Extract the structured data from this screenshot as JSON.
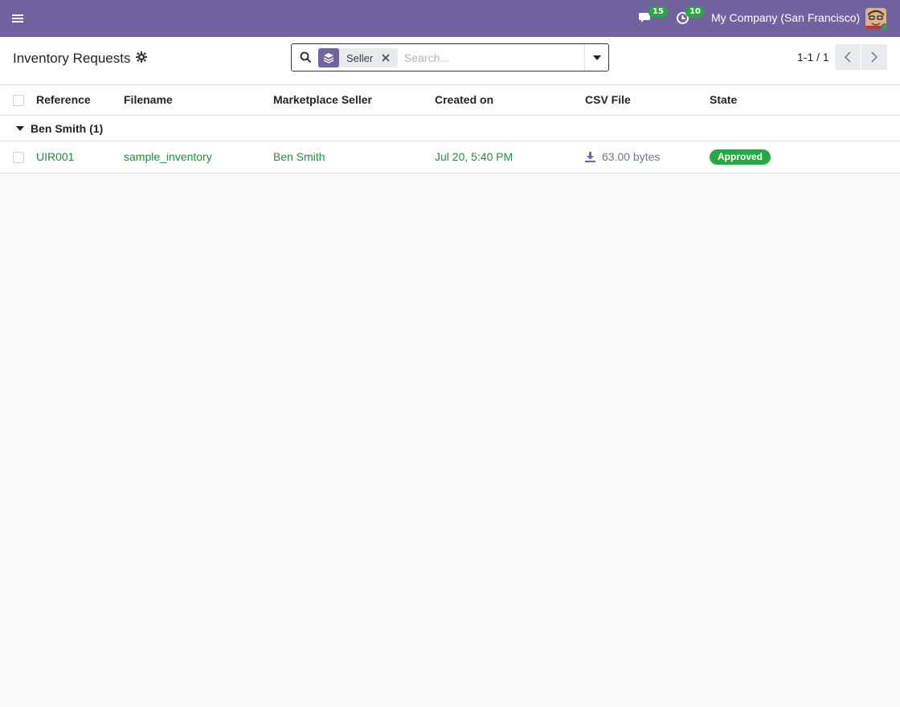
{
  "topbar": {
    "messages_count": "15",
    "activities_count": "10",
    "company": "My Company (San Francisco)"
  },
  "control_panel": {
    "title": "Inventory Requests",
    "search": {
      "facet_label": "Seller",
      "placeholder": "Search..."
    },
    "pager": {
      "value": "1-1 / 1"
    }
  },
  "table": {
    "columns": [
      "Reference",
      "Filename",
      "Marketplace Seller",
      "Created on",
      "CSV File",
      "State"
    ],
    "groups": [
      {
        "label": "Ben Smith (1)",
        "rows": [
          {
            "reference": "UIR001",
            "filename": "sample_inventory",
            "seller": "Ben Smith",
            "created_on": "Jul 20, 5:40 PM",
            "csv_file": "63.00 bytes",
            "state": "Approved"
          }
        ]
      }
    ]
  },
  "colors": {
    "brand": "#71639e",
    "link_green": "#1e8f3e",
    "success": "#28a745"
  },
  "icons": [
    "menu-icon",
    "chat-icon",
    "activity-clock-icon",
    "avatar",
    "gear-icon",
    "search-icon",
    "layers-icon",
    "close-icon",
    "caret-down-icon",
    "chevron-left-icon",
    "chevron-right-icon",
    "download-icon"
  ]
}
